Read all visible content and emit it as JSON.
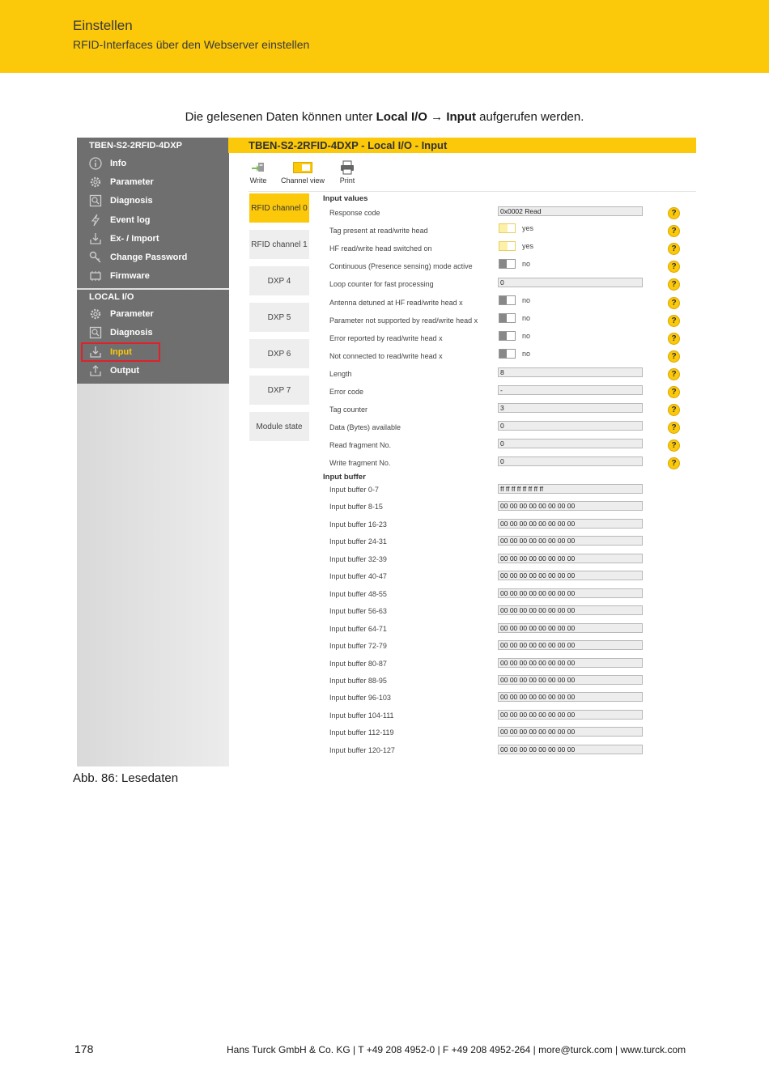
{
  "header": {
    "title": "Einstellen",
    "subtitle": "RFID-Interfaces über den Webserver einstellen"
  },
  "intro": {
    "pre": "Die gelesenen Daten können unter ",
    "local_io": "Local I/O",
    "arrow": "→",
    "input": "Input",
    "post": " aufgerufen werden."
  },
  "screenshot": {
    "sidebar": {
      "device_title": "TBEN-S2-2RFID-4DXP",
      "device_items": [
        {
          "label": "Info",
          "icon": "info-icon"
        },
        {
          "label": "Parameter",
          "icon": "gear-icon"
        },
        {
          "label": "Diagnosis",
          "icon": "diagnosis-icon"
        },
        {
          "label": "Event log",
          "icon": "lightning-icon"
        },
        {
          "label": "Ex- / Import",
          "icon": "import-export-icon"
        },
        {
          "label": "Change Password",
          "icon": "key-icon"
        },
        {
          "label": "Firmware",
          "icon": "chip-icon"
        }
      ],
      "local_title": "LOCAL I/O",
      "local_items": [
        {
          "label": "Parameter",
          "icon": "gear-icon"
        },
        {
          "label": "Diagnosis",
          "icon": "diagnosis-icon"
        },
        {
          "label": "Input",
          "icon": "input-icon",
          "active": true
        },
        {
          "label": "Output",
          "icon": "output-icon"
        }
      ]
    },
    "page_title": "TBEN-S2-2RFID-4DXP - Local I/O - Input",
    "toolbar": {
      "write": "Write",
      "channel_view": "Channel view",
      "print": "Print"
    },
    "tabs": [
      {
        "label": "RFID channel 0",
        "active": true
      },
      {
        "label": "RFID channel 1"
      },
      {
        "label": "DXP 4"
      },
      {
        "label": "DXP 5"
      },
      {
        "label": "DXP 6"
      },
      {
        "label": "DXP 7"
      },
      {
        "label": "Module state"
      }
    ],
    "input_values_title": "Input values",
    "fields": [
      {
        "label": "Response code",
        "type": "text",
        "value": "0x0002 Read"
      },
      {
        "label": "Tag present at read/write head",
        "type": "toggle",
        "on": true,
        "value": "yes"
      },
      {
        "label": "HF read/write head switched on",
        "type": "toggle",
        "on": true,
        "value": "yes"
      },
      {
        "label": "Continuous (Presence sensing) mode active",
        "type": "toggle",
        "on": false,
        "value": "no"
      },
      {
        "label": "Loop counter for fast processing",
        "type": "text",
        "value": "0"
      },
      {
        "label": "Antenna detuned at HF read/write head x",
        "type": "toggle",
        "on": false,
        "value": "no"
      },
      {
        "label": "Parameter not supported by read/write head x",
        "type": "toggle",
        "on": false,
        "value": "no"
      },
      {
        "label": "Error reported by read/write head x",
        "type": "toggle",
        "on": false,
        "value": "no"
      },
      {
        "label": "Not connected to read/write head x",
        "type": "toggle",
        "on": false,
        "value": "no"
      },
      {
        "label": "Length",
        "type": "text",
        "value": "8"
      },
      {
        "label": "Error code",
        "type": "text",
        "value": "-"
      },
      {
        "label": "Tag counter",
        "type": "text",
        "value": "3"
      },
      {
        "label": "Data (Bytes) available",
        "type": "text",
        "value": "0"
      },
      {
        "label": "Read fragment No.",
        "type": "text",
        "value": "0"
      },
      {
        "label": "Write fragment No.",
        "type": "text",
        "value": "0"
      }
    ],
    "help_glyph": "?",
    "input_buffer_title": "Input buffer",
    "buffers": [
      {
        "label": "Input buffer 0-7",
        "value": "ff ff ff ff ff ff ff ff"
      },
      {
        "label": "Input buffer 8-15",
        "value": "00 00 00 00 00 00 00 00"
      },
      {
        "label": "Input buffer 16-23",
        "value": "00 00 00 00 00 00 00 00"
      },
      {
        "label": "Input buffer 24-31",
        "value": "00 00 00 00 00 00 00 00"
      },
      {
        "label": "Input buffer 32-39",
        "value": "00 00 00 00 00 00 00 00"
      },
      {
        "label": "Input buffer 40-47",
        "value": "00 00 00 00 00 00 00 00"
      },
      {
        "label": "Input buffer 48-55",
        "value": "00 00 00 00 00 00 00 00"
      },
      {
        "label": "Input buffer 56-63",
        "value": "00 00 00 00 00 00 00 00"
      },
      {
        "label": "Input buffer 64-71",
        "value": "00 00 00 00 00 00 00 00"
      },
      {
        "label": "Input buffer 72-79",
        "value": "00 00 00 00 00 00 00 00"
      },
      {
        "label": "Input buffer 80-87",
        "value": "00 00 00 00 00 00 00 00"
      },
      {
        "label": "Input buffer 88-95",
        "value": "00 00 00 00 00 00 00 00"
      },
      {
        "label": "Input buffer 96-103",
        "value": "00 00 00 00 00 00 00 00"
      },
      {
        "label": "Input buffer 104-111",
        "value": "00 00 00 00 00 00 00 00"
      },
      {
        "label": "Input buffer 112-119",
        "value": "00 00 00 00 00 00 00 00"
      },
      {
        "label": "Input buffer 120-127",
        "value": "00 00 00 00 00 00 00 00"
      }
    ]
  },
  "caption": "Abb. 86: Lesedaten",
  "footer": {
    "page_number": "178",
    "text": "Hans Turck GmbH & Co. KG | T +49 208 4952-0 | F +49 208 4952-264 | more@turck.com | www.turck.com"
  },
  "colors": {
    "accent": "#fbc80a",
    "sidebar": "#6f6f6f",
    "highlight": "#e0202a"
  }
}
